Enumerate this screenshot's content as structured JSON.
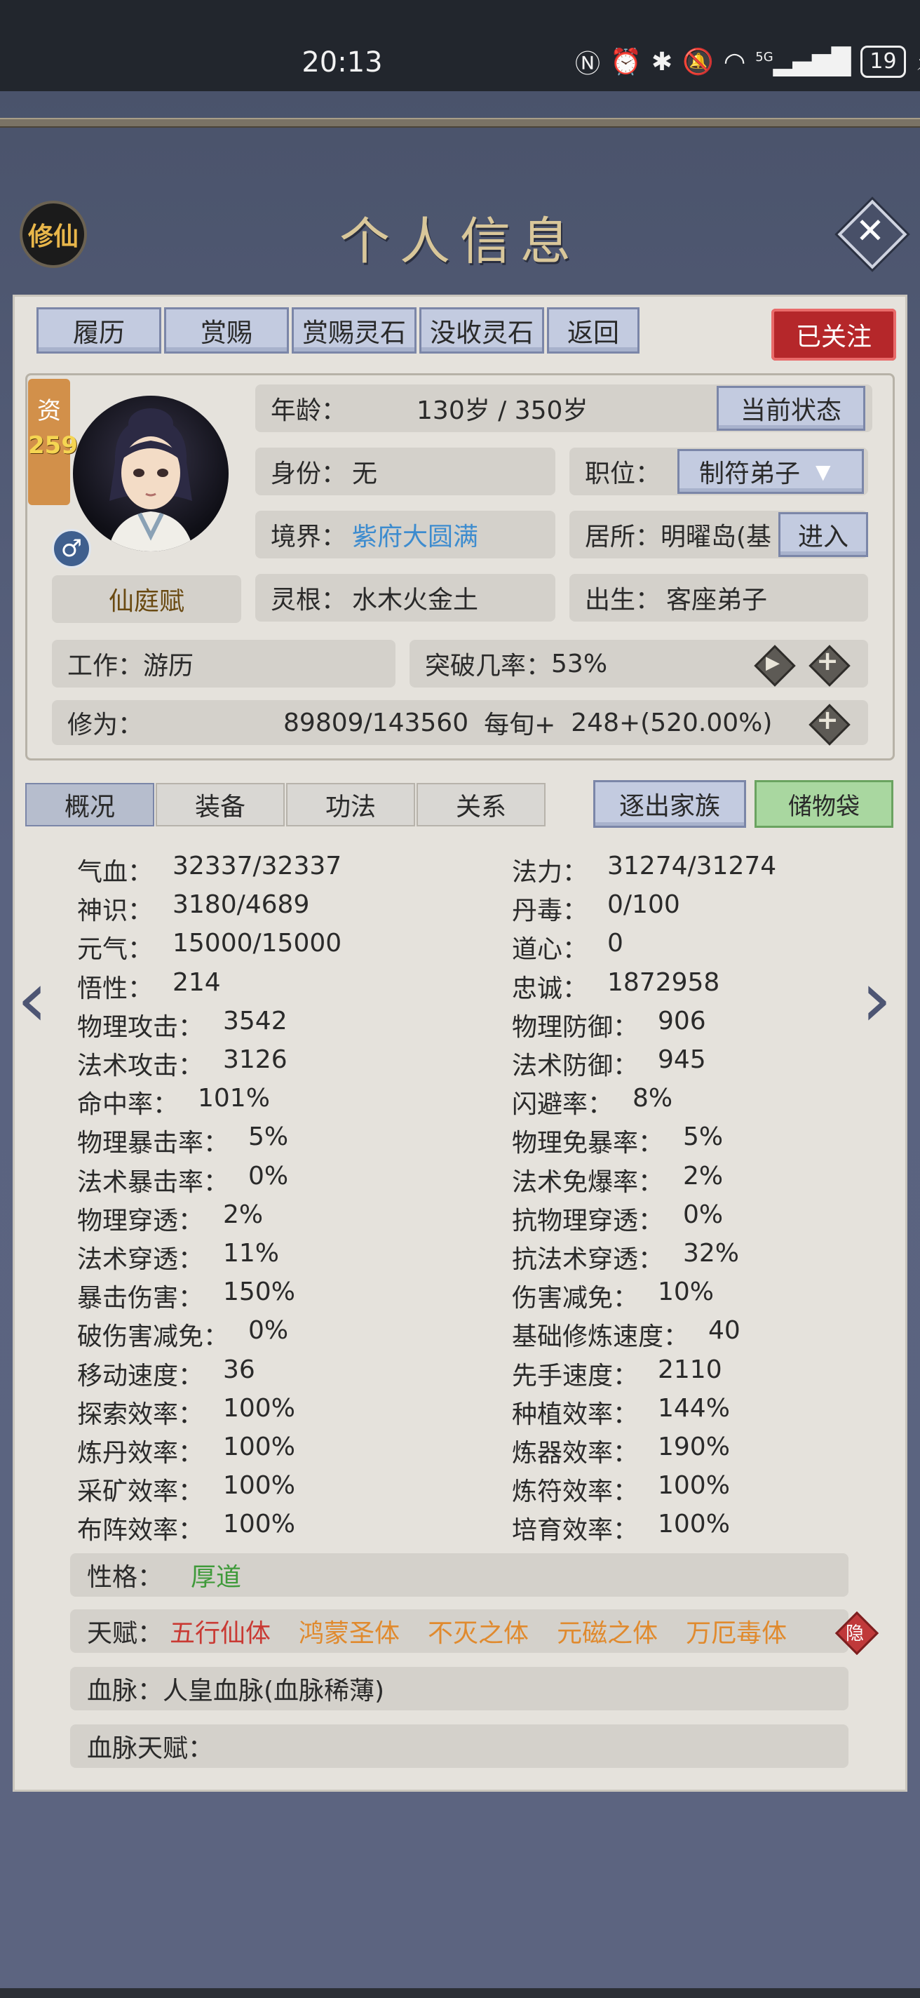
{
  "status_bar": {
    "time": "20:13",
    "icons": [
      "nfc-icon",
      "alarm-icon",
      "bluetooth-icon",
      "mute-icon",
      "wifi-icon",
      "5g-signal-icon",
      "battery-icon",
      "charging-icon"
    ],
    "network": "5G",
    "battery": "19"
  },
  "header": {
    "badge": "修仙",
    "title": "个人信息",
    "close_icon": "close-icon"
  },
  "top_tabs": [
    "履历",
    "赏赐",
    "赏赐灵石",
    "没收灵石",
    "返回"
  ],
  "follow_label": "已关注",
  "profile": {
    "zi_char": "资",
    "zi_value": "259",
    "name": "仙庭赋",
    "gender_icon": "male-icon",
    "age_label": "年龄：",
    "age_value": "130岁 / 350岁",
    "current_status_button": "当前状态",
    "identity_label": "身份：",
    "identity_value": "无",
    "position_label": "职位：",
    "position_value": "制符弟子",
    "realm_label": "境界：",
    "realm_value": "紫府大圆满",
    "residence_label": "居所：",
    "residence_value": "明曜岛(基",
    "enter_button": "进入",
    "spirit_root_label": "灵根：",
    "spirit_root_value": "水木火金土",
    "birth_label": "出生：",
    "birth_value": "客座弟子",
    "work_label": "工作：",
    "work_value": "游历",
    "breakthrough_label": "突破几率：",
    "breakthrough_value": "53%",
    "cultivation_label": "修为：",
    "cultivation_value": "89809/143560",
    "per_tick_label": "每旬+",
    "per_tick_value": "248+(520.00%)"
  },
  "lower_tabs": [
    "概况",
    "装备",
    "功法",
    "关系"
  ],
  "expel_button": "逐出家族",
  "storage_button": "储物袋",
  "stats_left": [
    {
      "label": "气血：",
      "value": "32337/32337"
    },
    {
      "label": "神识：",
      "value": "3180/4689"
    },
    {
      "label": "元气：",
      "value": "15000/15000"
    },
    {
      "label": "悟性：",
      "value": "214"
    },
    {
      "label": "物理攻击：",
      "value": "3542"
    },
    {
      "label": "法术攻击：",
      "value": "3126"
    },
    {
      "label": "命中率：",
      "value": "101%"
    },
    {
      "label": "物理暴击率：",
      "value": "5%"
    },
    {
      "label": "法术暴击率：",
      "value": "0%"
    },
    {
      "label": "物理穿透：",
      "value": "2%"
    },
    {
      "label": "法术穿透：",
      "value": "11%"
    },
    {
      "label": "暴击伤害：",
      "value": "150%"
    },
    {
      "label": "破伤害减免：",
      "value": "0%"
    },
    {
      "label": "移动速度：",
      "value": "36"
    },
    {
      "label": "探索效率：",
      "value": "100%"
    },
    {
      "label": "炼丹效率：",
      "value": "100%"
    },
    {
      "label": "采矿效率：",
      "value": "100%"
    },
    {
      "label": "布阵效率：",
      "value": "100%"
    }
  ],
  "stats_right": [
    {
      "label": "法力：",
      "value": "31274/31274"
    },
    {
      "label": "丹毒：",
      "value": "0/100"
    },
    {
      "label": "道心：",
      "value": "0"
    },
    {
      "label": "忠诚：",
      "value": "1872958"
    },
    {
      "label": "物理防御：",
      "value": "906"
    },
    {
      "label": "法术防御：",
      "value": "945"
    },
    {
      "label": "闪避率：",
      "value": "8%"
    },
    {
      "label": "物理免暴率：",
      "value": "5%"
    },
    {
      "label": "法术免爆率：",
      "value": "2%"
    },
    {
      "label": "抗物理穿透：",
      "value": "0%"
    },
    {
      "label": "抗法术穿透：",
      "value": "32%"
    },
    {
      "label": "伤害减免：",
      "value": "10%"
    },
    {
      "label": "基础修炼速度：",
      "value": "40"
    },
    {
      "label": "先手速度：",
      "value": "2110"
    },
    {
      "label": "种植效率：",
      "value": "144%"
    },
    {
      "label": "炼器效率：",
      "value": "190%"
    },
    {
      "label": "炼符效率：",
      "value": "100%"
    },
    {
      "label": "培育效率：",
      "value": "100%"
    }
  ],
  "personality_label": "性格：",
  "personality_value": "厚道",
  "talent_label": "天赋：",
  "talents": [
    "五行仙体",
    "鸿蒙圣体",
    "不灭之体",
    "元磁之体",
    "万厄毒体"
  ],
  "hide_label": "隐",
  "bloodline_label": "血脉：",
  "bloodline_value": "人皇血脉(血脉稀薄)",
  "bloodline_talent_label": "血脉天赋：",
  "colors": {
    "realm": "#3d8ccf",
    "personality": "#3f9a3a",
    "talent_red": "#c93a34",
    "talent_orange": "#e08a2e",
    "follow_red": "#b5272a",
    "storage_green": "#a9d7a0"
  }
}
